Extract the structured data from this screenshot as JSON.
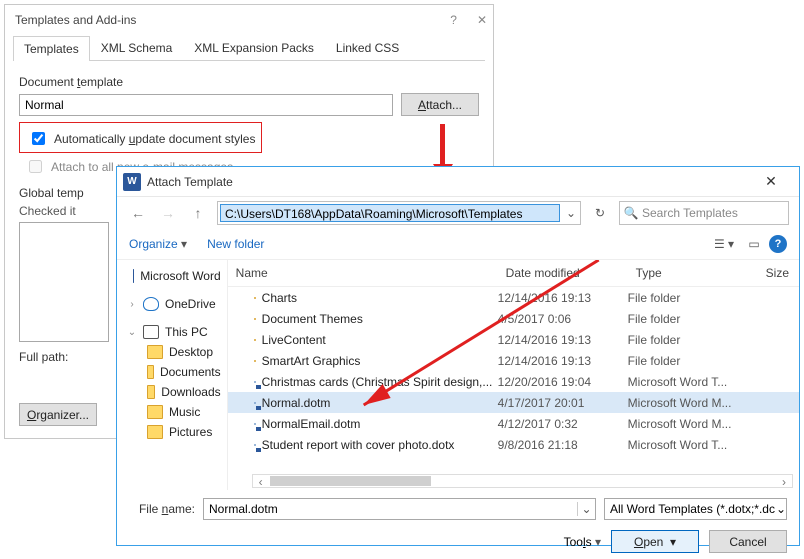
{
  "dlg1": {
    "title": "Templates and Add-ins",
    "tabs": [
      "Templates",
      "XML Schema",
      "XML Expansion Packs",
      "Linked CSS"
    ],
    "doc_template_label": "Document template",
    "doc_template_value": "Normal",
    "attach_btn": "Attach...",
    "chk_auto_update": "Automatically update document styles",
    "chk_attach_all": "Attach to all new e-mail messages",
    "global_label": "Global templates and add-ins",
    "checked_label": "Checked items are currently loaded.",
    "full_path_label": "Full path:",
    "organizer_btn": "Organizer..."
  },
  "dlg2": {
    "title": "Attach Template",
    "address": "C:\\Users\\DT168\\AppData\\Roaming\\Microsoft\\Templates",
    "search_placeholder": "Search Templates",
    "organize": "Organize",
    "new_folder": "New folder",
    "tree": {
      "word": "Microsoft Word",
      "onedrive": "OneDrive",
      "thispc": "This PC",
      "desktop": "Desktop",
      "documents": "Documents",
      "downloads": "Downloads",
      "music": "Music",
      "pictures": "Pictures"
    },
    "cols": {
      "name": "Name",
      "date": "Date modified",
      "type": "Type",
      "size": "Size"
    },
    "rows": [
      {
        "icon": "folder",
        "name": "Charts",
        "date": "12/14/2016 19:13",
        "type": "File folder"
      },
      {
        "icon": "folder",
        "name": "Document Themes",
        "date": "4/5/2017 0:06",
        "type": "File folder"
      },
      {
        "icon": "folder",
        "name": "LiveContent",
        "date": "12/14/2016 19:13",
        "type": "File folder"
      },
      {
        "icon": "folder",
        "name": "SmartArt Graphics",
        "date": "12/14/2016 19:13",
        "type": "File folder"
      },
      {
        "icon": "doc",
        "name": "Christmas cards (Christmas Spirit design,...",
        "date": "12/20/2016 19:04",
        "type": "Microsoft Word T..."
      },
      {
        "icon": "doc",
        "name": "Normal.dotm",
        "date": "4/17/2017 20:01",
        "type": "Microsoft Word M...",
        "selected": true
      },
      {
        "icon": "doc",
        "name": "NormalEmail.dotm",
        "date": "4/12/2017 0:32",
        "type": "Microsoft Word M..."
      },
      {
        "icon": "doc",
        "name": "Student report with cover photo.dotx",
        "date": "9/8/2016 21:18",
        "type": "Microsoft Word T..."
      }
    ],
    "file_name_label": "File name:",
    "file_name_value": "Normal.dotm",
    "filter": "All Word Templates (*.dotx;*.dotm;*.dot)",
    "filter_display": "All Word Templates (*.dotx;*.dc",
    "tools": "Tools",
    "open": "Open",
    "cancel": "Cancel"
  }
}
